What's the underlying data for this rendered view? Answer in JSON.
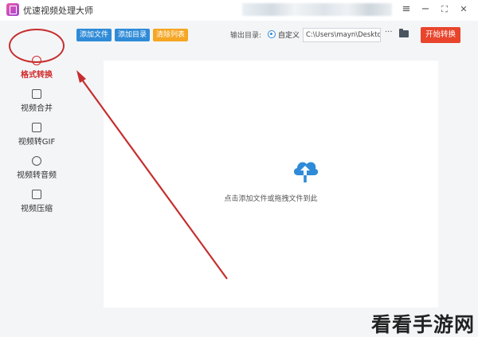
{
  "app": {
    "title": "优速视频处理大师"
  },
  "window_controls": {
    "menu": "≡",
    "minimize": "−",
    "maximize": "⛶",
    "close": "✕"
  },
  "sidebar": {
    "items": [
      {
        "label": "格式转换",
        "icon": "format-convert-icon",
        "active": true
      },
      {
        "label": "视频合并",
        "icon": "video-merge-icon"
      },
      {
        "label": "视频转GIF",
        "icon": "gif-icon"
      },
      {
        "label": "视频转音频",
        "icon": "audio-icon"
      },
      {
        "label": "视频压缩",
        "icon": "compress-icon"
      }
    ]
  },
  "toolbar": {
    "add_file": "添加文件",
    "add_folder": "添加目录",
    "clear_list": "清除列表",
    "output_label": "输出目录:",
    "custom_option": "自定义",
    "output_path": "C:\\Users\\mayn\\Desktop",
    "more": "···",
    "start": "开始转换"
  },
  "dropzone": {
    "hint": "点击添加文件或拖拽文件到此"
  },
  "watermark": "看看手游网",
  "colors": {
    "accent_blue": "#2f8bd8",
    "accent_orange": "#f5a623",
    "start_red": "#e8452c",
    "annotation_red": "#c62e2e"
  }
}
